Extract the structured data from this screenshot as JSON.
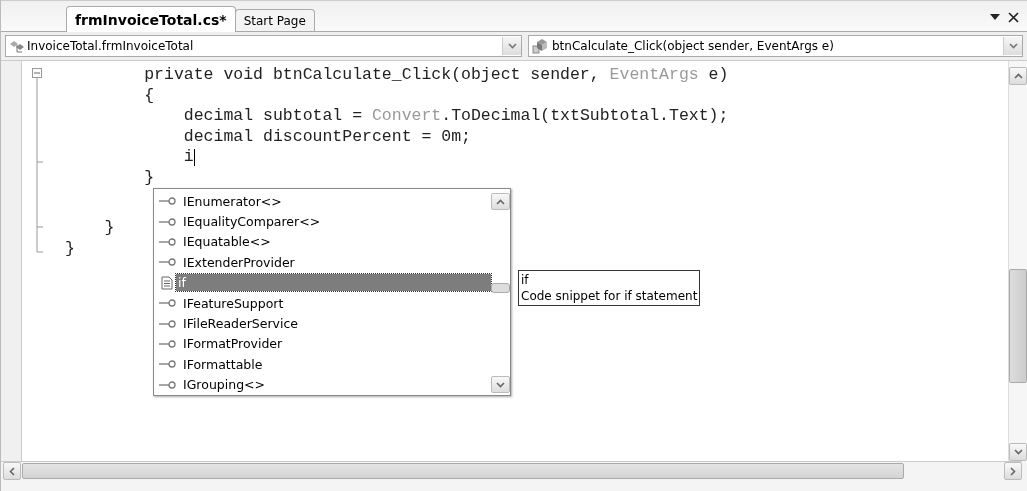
{
  "tabs": [
    {
      "label": "frmInvoiceTotal.cs*",
      "selected": true
    },
    {
      "label": "Start Page",
      "selected": false
    }
  ],
  "type_dropdown": {
    "value": "InvoiceTotal.frmInvoiceTotal"
  },
  "member_dropdown": {
    "value": "btnCalculate_Click(object sender, EventArgs e)"
  },
  "code_lines": [
    {
      "children": [
        {
          "children": [
            {
              "segments": [
                {
                  "kind": "plain",
                  "text": "private void btnCalculate_Click(object sender, "
                },
                {
                  "kind": "type",
                  "text": "EventArgs"
                },
                {
                  "kind": "plain",
                  "text": " e)"
                }
              ]
            },
            {
              "segments": [
                {
                  "kind": "plain",
                  "text": "{"
                }
              ]
            },
            {
              "children": [
                {
                  "segments": [
                    {
                      "kind": "plain",
                      "text": "decimal subtotal = "
                    },
                    {
                      "kind": "type",
                      "text": "Convert"
                    },
                    {
                      "kind": "plain",
                      "text": ".ToDecimal(txtSubtotal.Text);"
                    }
                  ]
                },
                {
                  "segments": [
                    {
                      "kind": "plain",
                      "text": "decimal discountPercent = 0m;"
                    }
                  ]
                },
                {
                  "segments": [
                    {
                      "kind": "plain",
                      "text": "i"
                    }
                  ],
                  "caret": true
                }
              ]
            },
            {
              "segments": [
                {
                  "kind": "plain",
                  "text": "}"
                }
              ]
            }
          ]
        },
        {
          "segments": [
            {
              "kind": "plain",
              "text": "}"
            }
          ]
        }
      ]
    },
    {
      "segments": [
        {
          "kind": "plain",
          "text": "}"
        }
      ]
    }
  ],
  "completion_list": {
    "items": [
      {
        "kind": "interface",
        "label": "IEnumerator<>",
        "selected": false
      },
      {
        "kind": "interface",
        "label": "IEqualityComparer<>",
        "selected": false
      },
      {
        "kind": "interface",
        "label": "IEquatable<>",
        "selected": false
      },
      {
        "kind": "interface",
        "label": "IExtenderProvider",
        "selected": false
      },
      {
        "kind": "snippet",
        "label": "if",
        "selected": true
      },
      {
        "kind": "interface",
        "label": "IFeatureSupport",
        "selected": false
      },
      {
        "kind": "interface",
        "label": "IFileReaderService",
        "selected": false
      },
      {
        "kind": "interface",
        "label": "IFormatProvider",
        "selected": false
      },
      {
        "kind": "interface",
        "label": "IFormattable",
        "selected": false
      },
      {
        "kind": "interface",
        "label": "IGrouping<>",
        "selected": false
      }
    ]
  },
  "tooltip": {
    "title": "if",
    "description": "Code snippet for if statement"
  }
}
